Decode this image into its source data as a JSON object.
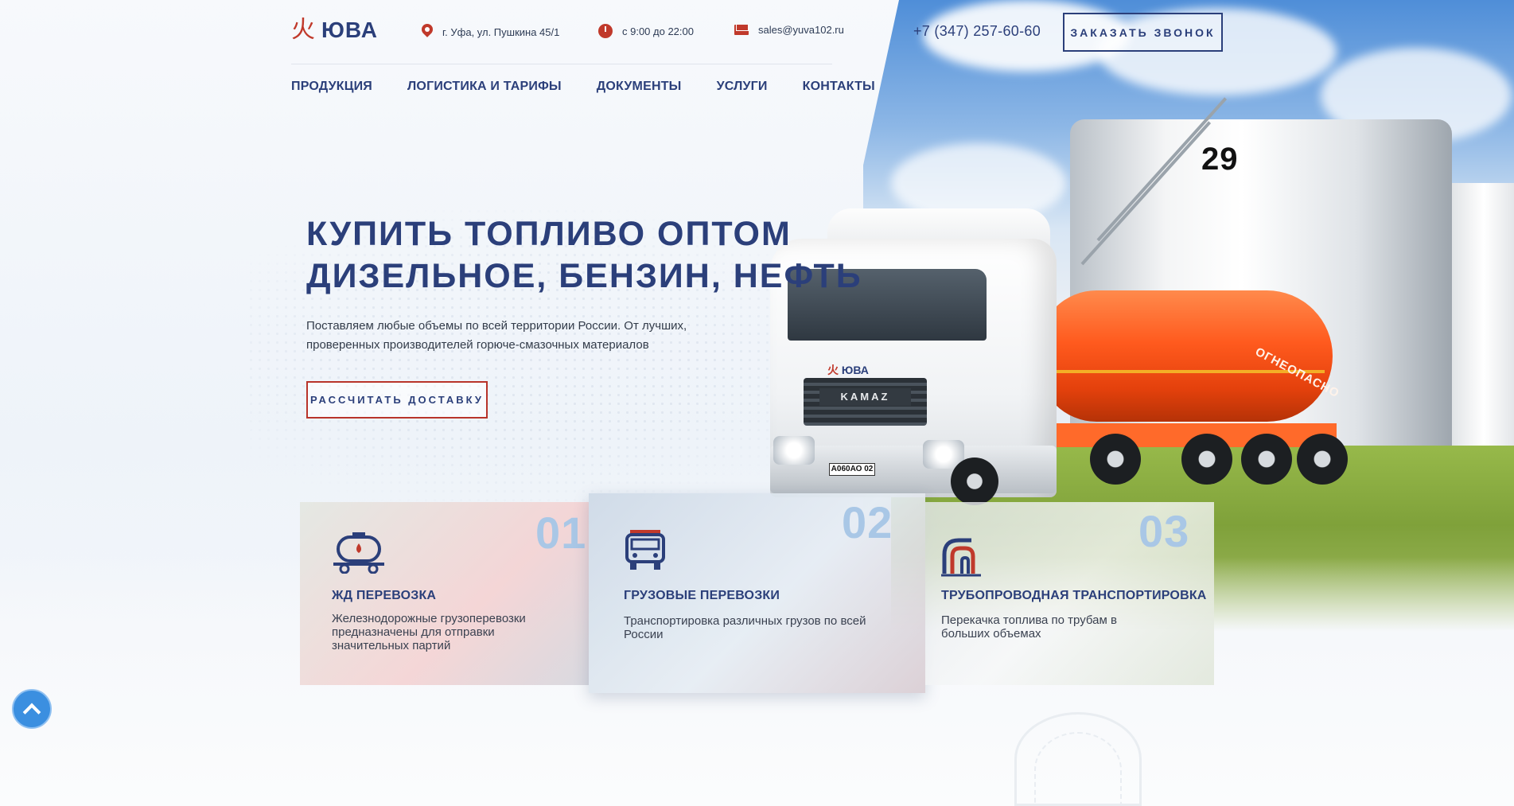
{
  "brand": {
    "mark": "火",
    "name": "ЮВА",
    "accent": "#c0392b",
    "primary": "#2b3f7a"
  },
  "header": {
    "address": "г. Уфа, ул. Пушкина 45/1",
    "hours": "с 9:00 до 22:00",
    "email": "sales@yuva102.ru",
    "phone": "+7 (347) 257-60-60",
    "callback_label": "ЗАКАЗАТЬ ЗВОНОК"
  },
  "nav": {
    "items": [
      {
        "label": "ПРОДУКЦИЯ"
      },
      {
        "label": "ЛОГИСТИКА И ТАРИФЫ"
      },
      {
        "label": "ДОКУМЕНТЫ"
      },
      {
        "label": "УСЛУГИ"
      },
      {
        "label": "КОНТАКТЫ"
      }
    ]
  },
  "hero": {
    "title_line1": "КУПИТЬ ТОПЛИВО ОПТОМ",
    "title_line2": "ДИЗЕЛЬНОЕ, БЕНЗИН, НЕФТЬ",
    "lead": "Поставляем любые объемы по всей территории России. От лучших, проверенных производителей горюче-смазочных материалов",
    "cta_label": "РАССЧИТАТЬ ДОСТАВКУ",
    "image": {
      "tank_number": "29",
      "truck_brand": "KAMAZ",
      "truck_logo_mark": "火",
      "truck_logo_name": "ЮВА",
      "plate": "А060АО 02",
      "trailer_text": "ОГНЕОПАСНО"
    }
  },
  "services": [
    {
      "num": "01",
      "title": "ЖД ПЕРЕВОЗКА",
      "text": "Железнодорожные грузоперевозки предназначены для отправки значительных партий",
      "icon": "rail-tank-icon"
    },
    {
      "num": "02",
      "title": "ГРУЗОВЫЕ ПЕРЕВОЗКИ",
      "text": "Транспортировка различных грузов по всей России",
      "icon": "truck-icon"
    },
    {
      "num": "03",
      "title": "ТРУБОПРОВОДНАЯ ТРАНСПОРТИРОВКА",
      "text": "Перекачка топлива по трубам в больших объемах",
      "icon": "pipeline-icon"
    }
  ],
  "scroll_top": {
    "icon": "chevron-up-icon"
  }
}
